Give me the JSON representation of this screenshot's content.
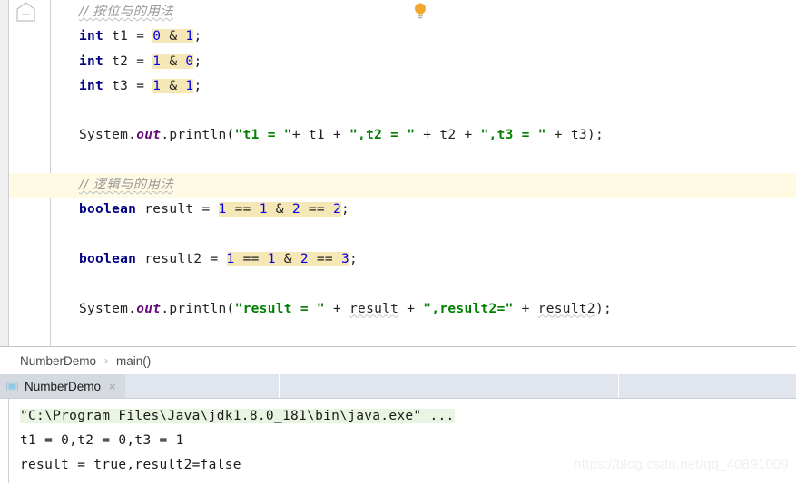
{
  "editor": {
    "gutter": {
      "fold_marker": "fold-region-marker"
    },
    "intention_bulb": "lightbulb-icon",
    "lines": [
      {
        "id": "line-comment-bitwise",
        "kind": "comment",
        "caret": false,
        "text": "// 按位与的用法"
      },
      {
        "id": "line-int-t1",
        "kind": "code",
        "caret": false,
        "tokens": [
          {
            "t": "int",
            "c": "kw"
          },
          {
            "t": " t1 = ",
            "c": "plain"
          },
          {
            "t": "0",
            "c": "num hl"
          },
          {
            "t": " ",
            "c": "plain hl"
          },
          {
            "t": "& ",
            "c": "plain hl"
          },
          {
            "t": "1",
            "c": "num hl"
          },
          {
            "t": ";",
            "c": "plain"
          }
        ]
      },
      {
        "id": "line-int-t2",
        "kind": "code",
        "caret": false,
        "tokens": [
          {
            "t": "int",
            "c": "kw"
          },
          {
            "t": " t2 = ",
            "c": "plain"
          },
          {
            "t": "1",
            "c": "num hl"
          },
          {
            "t": " ",
            "c": "plain hl"
          },
          {
            "t": "& ",
            "c": "plain hl"
          },
          {
            "t": "0",
            "c": "num hl"
          },
          {
            "t": ";",
            "c": "plain"
          }
        ]
      },
      {
        "id": "line-int-t3",
        "kind": "code",
        "caret": false,
        "tokens": [
          {
            "t": "int",
            "c": "kw"
          },
          {
            "t": " t3 = ",
            "c": "plain"
          },
          {
            "t": "1",
            "c": "num hl"
          },
          {
            "t": " ",
            "c": "plain hl"
          },
          {
            "t": "& ",
            "c": "plain hl"
          },
          {
            "t": "1",
            "c": "num hl"
          },
          {
            "t": ";",
            "c": "plain"
          }
        ]
      },
      {
        "id": "line-blank-1",
        "kind": "blank",
        "caret": false,
        "tokens": []
      },
      {
        "id": "line-println-t",
        "kind": "code",
        "caret": false,
        "tokens": [
          {
            "t": "System.",
            "c": "plain"
          },
          {
            "t": "out",
            "c": "field"
          },
          {
            "t": ".println(",
            "c": "plain"
          },
          {
            "t": "\"t1 = \"",
            "c": "str"
          },
          {
            "t": "+ t1 + ",
            "c": "plain"
          },
          {
            "t": "\",t2 = \"",
            "c": "str"
          },
          {
            "t": " + t2 + ",
            "c": "plain"
          },
          {
            "t": "\",t3 = \"",
            "c": "str"
          },
          {
            "t": " + t3);",
            "c": "plain"
          }
        ]
      },
      {
        "id": "line-blank-2",
        "kind": "blank",
        "caret": false,
        "tokens": []
      },
      {
        "id": "line-comment-logical",
        "kind": "comment",
        "caret": true,
        "text": "// 逻辑与的用法"
      },
      {
        "id": "line-boolean-result",
        "kind": "code",
        "caret": false,
        "tokens": [
          {
            "t": "boolean",
            "c": "kw"
          },
          {
            "t": " result = ",
            "c": "plain"
          },
          {
            "t": "1",
            "c": "num hl"
          },
          {
            "t": " == ",
            "c": "plain hl"
          },
          {
            "t": "1",
            "c": "num hl"
          },
          {
            "t": " & ",
            "c": "plain hl"
          },
          {
            "t": "2",
            "c": "num hl"
          },
          {
            "t": " == ",
            "c": "plain hl"
          },
          {
            "t": "2",
            "c": "num hl"
          },
          {
            "t": ";",
            "c": "plain"
          }
        ]
      },
      {
        "id": "line-blank-3",
        "kind": "blank",
        "caret": false,
        "tokens": []
      },
      {
        "id": "line-boolean-result2",
        "kind": "code",
        "caret": false,
        "tokens": [
          {
            "t": "boolean",
            "c": "kw"
          },
          {
            "t": " result2 = ",
            "c": "plain"
          },
          {
            "t": "1",
            "c": "num hl"
          },
          {
            "t": " == ",
            "c": "plain hl"
          },
          {
            "t": "1",
            "c": "num hl"
          },
          {
            "t": " & ",
            "c": "plain hl"
          },
          {
            "t": "2",
            "c": "num hl"
          },
          {
            "t": " == ",
            "c": "plain hl"
          },
          {
            "t": "3",
            "c": "num hl"
          },
          {
            "t": ";",
            "c": "plain"
          }
        ]
      },
      {
        "id": "line-blank-4",
        "kind": "blank",
        "caret": false,
        "tokens": []
      },
      {
        "id": "line-println-result",
        "kind": "code",
        "caret": false,
        "tokens": [
          {
            "t": "System.",
            "c": "plain"
          },
          {
            "t": "out",
            "c": "field"
          },
          {
            "t": ".println(",
            "c": "plain"
          },
          {
            "t": "\"result = \"",
            "c": "str"
          },
          {
            "t": " + ",
            "c": "plain"
          },
          {
            "t": "result",
            "c": "plain typo"
          },
          {
            "t": " + ",
            "c": "plain"
          },
          {
            "t": "\",result2=\"",
            "c": "str"
          },
          {
            "t": " + ",
            "c": "plain"
          },
          {
            "t": "result2",
            "c": "plain typo"
          },
          {
            "t": ");",
            "c": "plain"
          }
        ]
      }
    ]
  },
  "breadcrumb": {
    "class_name": "NumberDemo",
    "separator": "›",
    "method_name": "main()"
  },
  "run_window": {
    "tab": {
      "icon": "run-configuration-icon",
      "label": "NumberDemo",
      "close": "×"
    },
    "console": {
      "command_line": "\"C:\\Program Files\\Java\\jdk1.8.0_181\\bin\\java.exe\" ...",
      "output_lines": [
        "t1 = 0,t2 = 0,t3 = 1",
        "result = true,result2=false"
      ]
    }
  },
  "watermark": "https://blog.csdn.net/qq_40891009",
  "colors": {
    "keyword": "#000080",
    "number": "#0000ee",
    "string": "#008000",
    "field": "#660e7a",
    "comment": "#9a9a9a",
    "usage_highlight": "#f6e7b6",
    "caret_row": "#fffae3",
    "console_command_bg": "#e9f5e2",
    "run_tabs_bg": "#e1e5ee",
    "bulb": "#f0a732"
  }
}
